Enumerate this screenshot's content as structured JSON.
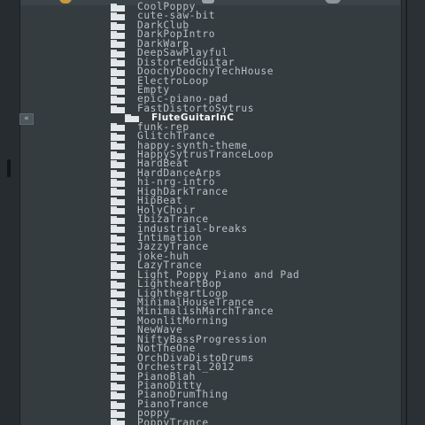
{
  "browser": {
    "items": [
      {
        "label": "CoolPoppy"
      },
      {
        "label": "cute-saw-bit"
      },
      {
        "label": "DarkClub"
      },
      {
        "label": "DarkPopIntro"
      },
      {
        "label": "DarkWarp"
      },
      {
        "label": "DeepSawPlayful"
      },
      {
        "label": "DistortedGuitar"
      },
      {
        "label": "DoochyDoochyTechHouse"
      },
      {
        "label": "ElectroLoop"
      },
      {
        "label": "Empty"
      },
      {
        "label": "epic-piano-pad"
      },
      {
        "label": "FastDistortoSytrus"
      },
      {
        "label": "FluteGuitarInC",
        "selected": true
      },
      {
        "label": "funk-rep"
      },
      {
        "label": "GlitchTrance"
      },
      {
        "label": "happy-synth-theme"
      },
      {
        "label": "HappySytrusTranceLoop"
      },
      {
        "label": "HardBeat"
      },
      {
        "label": "HardDanceArps"
      },
      {
        "label": "hi-nrg-intro"
      },
      {
        "label": "HighDarkTrance"
      },
      {
        "label": "HipBeat"
      },
      {
        "label": "HolyChoir"
      },
      {
        "label": "IbizaTrance"
      },
      {
        "label": "industrial-breaks"
      },
      {
        "label": "Intimation"
      },
      {
        "label": "JazzyTrance"
      },
      {
        "label": "joke-huh"
      },
      {
        "label": "LazyTrance"
      },
      {
        "label": "Light Poppy Piano and Pad"
      },
      {
        "label": "LightheartBop"
      },
      {
        "label": "LightheartLoop"
      },
      {
        "label": "MinimalHouseTrance"
      },
      {
        "label": "MinimalishMarchTrance"
      },
      {
        "label": "MoonlitMorning"
      },
      {
        "label": "NewWave"
      },
      {
        "label": "NiftyBassProgression"
      },
      {
        "label": "NotTheOne"
      },
      {
        "label": "OrchDivaDistoDrums"
      },
      {
        "label": "Orchestral_2012"
      },
      {
        "label": "PianoBlah"
      },
      {
        "label": "PianoDitty"
      },
      {
        "label": "PianoDrumThing"
      },
      {
        "label": "PianoTrance"
      },
      {
        "label": "poppy"
      },
      {
        "label": "PoppyTrance"
      }
    ]
  },
  "collapse_button": {
    "glyph": "«"
  },
  "colors": {
    "background": "#343c40",
    "text": "#b8c2c6",
    "selected_text": "#f2f5f6",
    "folder_icon": "#e3e7e9"
  }
}
